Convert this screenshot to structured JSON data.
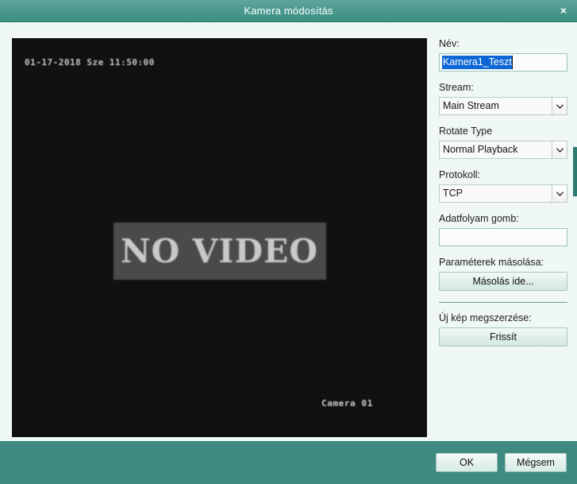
{
  "window": {
    "title": "Kamera módosítás",
    "close_label": "×"
  },
  "preview": {
    "osd_timestamp": "01-17-2018 Sze 11:50:00",
    "osd_camera": "Camera 01",
    "no_video_text": "NO VIDEO"
  },
  "form": {
    "name": {
      "label": "Név:",
      "value": "Kamera1_Teszt",
      "selected": true
    },
    "stream": {
      "label": "Stream:",
      "value": "Main Stream"
    },
    "rotate_type": {
      "label": "Rotate Type",
      "value": "Normal Playback"
    },
    "protocol": {
      "label": "Protokoll:",
      "value": "TCP"
    },
    "datastream_button": {
      "label": "Adatfolyam gomb:",
      "value": ""
    },
    "copy_params": {
      "label": "Paraméterek másolása:",
      "button_label": "Másolás ide..."
    },
    "refresh_image": {
      "label": "Új kép megszerzése:",
      "button_label": "Frissít"
    }
  },
  "footer": {
    "ok_label": "OK",
    "cancel_label": "Mégsem"
  },
  "colors": {
    "titlebar_teal": "#4b9a8f",
    "footer_teal": "#3e8a80",
    "panel_background": "#eff8f5",
    "selection_blue": "#0c66d6",
    "video_black": "#111111"
  }
}
